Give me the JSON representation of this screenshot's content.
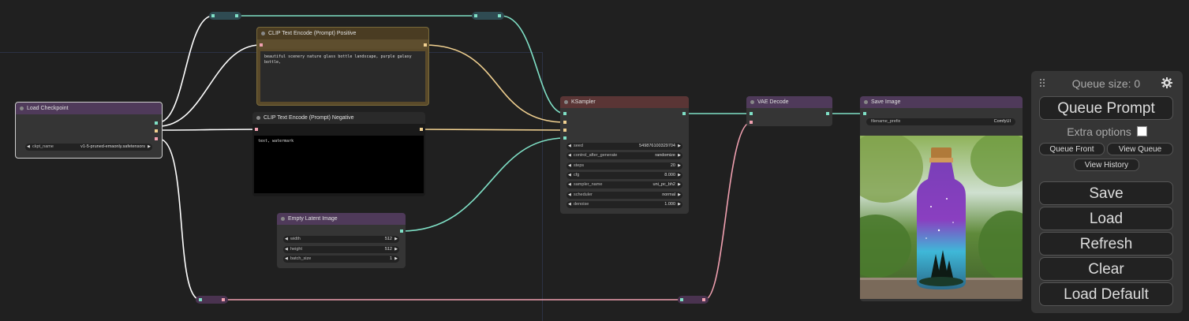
{
  "nodes": {
    "load_checkpoint": {
      "title": "Load Checkpoint",
      "widgets": [
        {
          "name": "ckpt_name",
          "value": "v1-5-pruned-emaonly.safetensors"
        }
      ]
    },
    "clip_positive": {
      "title": "CLIP Text Encode (Prompt) Positive",
      "text": "beautiful scenery nature glass bottle landscape, purple galaxy bottle,"
    },
    "clip_negative": {
      "title": "CLIP Text Encode (Prompt) Negative",
      "text": "text, watermark"
    },
    "empty_latent": {
      "title": "Empty Latent Image",
      "widgets": [
        {
          "name": "width",
          "value": "512"
        },
        {
          "name": "height",
          "value": "512"
        },
        {
          "name": "batch_size",
          "value": "1"
        }
      ]
    },
    "ksampler": {
      "title": "KSampler",
      "widgets": [
        {
          "name": "seed",
          "value": "549876100329704"
        },
        {
          "name": "control_after_generate",
          "value": "randomize"
        },
        {
          "name": "steps",
          "value": "20"
        },
        {
          "name": "cfg",
          "value": "8.000"
        },
        {
          "name": "sampler_name",
          "value": "uni_pc_bh2"
        },
        {
          "name": "scheduler",
          "value": "normal"
        },
        {
          "name": "denoise",
          "value": "1.000"
        }
      ]
    },
    "vae_decode": {
      "title": "VAE Decode"
    },
    "save_image": {
      "title": "Save Image",
      "widgets": [
        {
          "name": "filename_prefix",
          "value": "ComfyUI"
        }
      ]
    }
  },
  "queue_panel": {
    "queue_size_label": "Queue size: 0",
    "queue_prompt": "Queue Prompt",
    "extra_options": "Extra options",
    "queue_front": "Queue Front",
    "view_queue": "View Queue",
    "view_history": "View History",
    "save": "Save",
    "load": "Load",
    "refresh": "Refresh",
    "clear": "Clear",
    "load_default": "Load Default"
  },
  "colors": {
    "canvas": "#202020",
    "node_body": "#353535",
    "purple_title": "#4f3a5a",
    "brown_title": "#5a4a2a",
    "red_title": "#5a3535",
    "model_wire": "#ffffff",
    "clip_wire": "#7fe0c6",
    "conditioning_wire": "#f0d090",
    "vae_wire": "#f0a0b0"
  },
  "icons": {
    "settings": "gear-icon",
    "drag_handle": "drag-dots-icon",
    "widget_left": "triangle-left-icon",
    "widget_right": "triangle-right-icon"
  }
}
